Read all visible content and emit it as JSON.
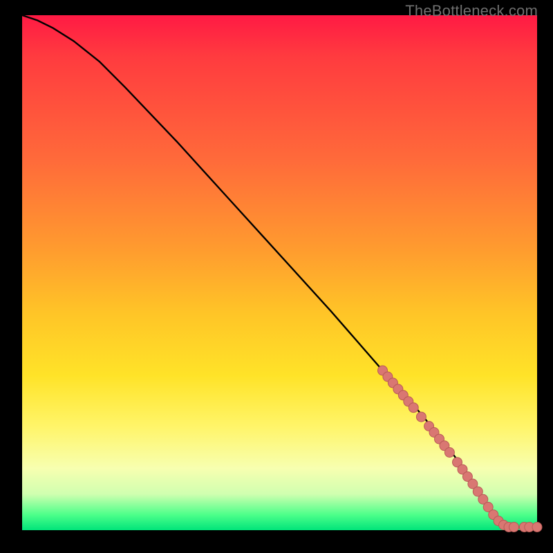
{
  "watermark": "TheBottleneck.com",
  "colors": {
    "background": "#000000",
    "curve": "#000000",
    "point_fill": "#d97772",
    "point_stroke": "#b85a56",
    "gradient_top": "#ff1a44",
    "gradient_bottom": "#00e47a"
  },
  "chart_data": {
    "type": "line",
    "title": "",
    "xlabel": "",
    "ylabel": "",
    "xlim": [
      0,
      100
    ],
    "ylim": [
      0,
      100
    ],
    "series": [
      {
        "name": "curve",
        "x": [
          0,
          3,
          6,
          10,
          15,
          20,
          30,
          40,
          50,
          60,
          70,
          75,
          80,
          85,
          88,
          90,
          92,
          94,
          96,
          98,
          100
        ],
        "y": [
          100,
          99,
          97.5,
          95,
          91,
          86,
          75.5,
          64.5,
          53.5,
          42.5,
          31,
          25.5,
          19.5,
          13,
          8.5,
          5,
          2.5,
          1,
          0.6,
          0.6,
          0.6
        ]
      }
    ],
    "points": [
      {
        "x": 70.0,
        "y": 31.0
      },
      {
        "x": 71.0,
        "y": 29.8
      },
      {
        "x": 72.0,
        "y": 28.6
      },
      {
        "x": 73.0,
        "y": 27.4
      },
      {
        "x": 74.0,
        "y": 26.2
      },
      {
        "x": 75.0,
        "y": 25.0
      },
      {
        "x": 76.0,
        "y": 23.8
      },
      {
        "x": 77.5,
        "y": 22.0
      },
      {
        "x": 79.0,
        "y": 20.2
      },
      {
        "x": 80.0,
        "y": 19.0
      },
      {
        "x": 81.0,
        "y": 17.7
      },
      {
        "x": 82.0,
        "y": 16.4
      },
      {
        "x": 83.0,
        "y": 15.1
      },
      {
        "x": 84.5,
        "y": 13.2
      },
      {
        "x": 85.5,
        "y": 11.8
      },
      {
        "x": 86.5,
        "y": 10.4
      },
      {
        "x": 87.5,
        "y": 9.0
      },
      {
        "x": 88.5,
        "y": 7.5
      },
      {
        "x": 89.5,
        "y": 6.0
      },
      {
        "x": 90.5,
        "y": 4.5
      },
      {
        "x": 91.5,
        "y": 3.0
      },
      {
        "x": 92.5,
        "y": 1.8
      },
      {
        "x": 93.5,
        "y": 1.0
      },
      {
        "x": 94.5,
        "y": 0.6
      },
      {
        "x": 95.5,
        "y": 0.6
      },
      {
        "x": 97.5,
        "y": 0.6
      },
      {
        "x": 98.5,
        "y": 0.6
      },
      {
        "x": 100.0,
        "y": 0.6
      }
    ]
  }
}
